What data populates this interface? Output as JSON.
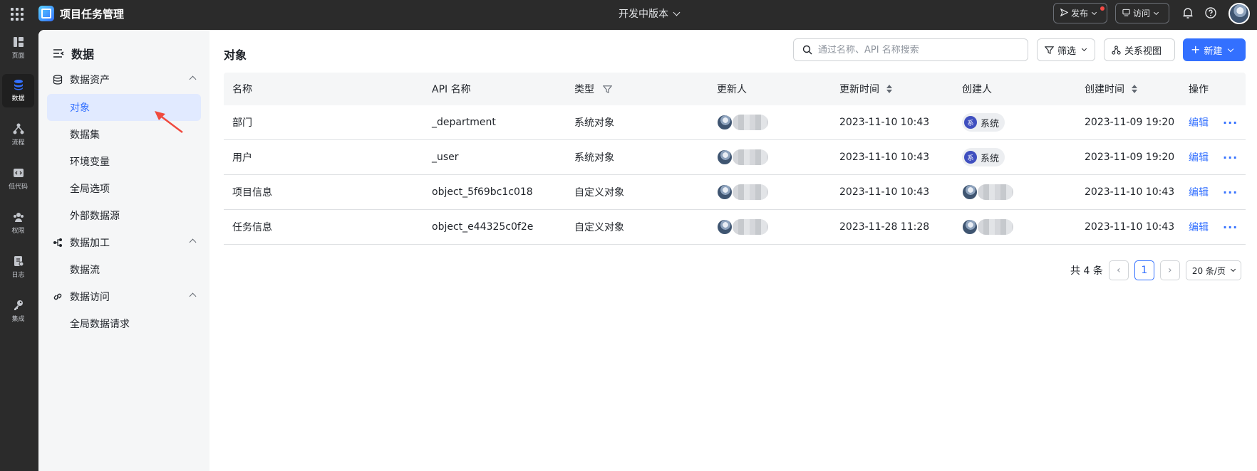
{
  "app": {
    "title": "项目任务管理",
    "version": "开发中版本"
  },
  "topbar": {
    "publish": "发布",
    "visit": "访问"
  },
  "rail": [
    {
      "label": "页面",
      "icon": "pages-icon"
    },
    {
      "label": "数据",
      "icon": "database-icon",
      "active": true
    },
    {
      "label": "流程",
      "icon": "flow-icon"
    },
    {
      "label": "低代码",
      "icon": "code-icon"
    },
    {
      "label": "权限",
      "icon": "users-icon"
    },
    {
      "label": "日志",
      "icon": "log-icon"
    },
    {
      "label": "集成",
      "icon": "key-icon"
    }
  ],
  "sidebar": {
    "title": "数据",
    "groups": [
      {
        "label": "数据资产",
        "items": [
          "对象",
          "数据集",
          "环境变量",
          "全局选项",
          "外部数据源"
        ]
      },
      {
        "label": "数据加工",
        "items": [
          "数据流"
        ]
      },
      {
        "label": "数据访问",
        "items": [
          "全局数据请求"
        ]
      }
    ]
  },
  "main": {
    "title": "对象",
    "search_placeholder": "通过名称、API 名称搜索",
    "filter": "筛选",
    "relation_view": "关系视图",
    "new": "新建"
  },
  "table": {
    "headers": {
      "name": "名称",
      "api": "API 名称",
      "type": "类型",
      "updater": "更新人",
      "updated": "更新时间",
      "creator": "创建人",
      "created": "创建时间",
      "ops": "操作"
    },
    "rows": [
      {
        "name": "部门",
        "api": "_department",
        "type": "系统对象",
        "updated": "2023-11-10 10:43",
        "creator": "系统",
        "created": "2023-11-09 19:20",
        "edit": "编辑",
        "more": "···"
      },
      {
        "name": "用户",
        "api": "_user",
        "type": "系统对象",
        "updated": "2023-11-10 10:43",
        "creator": "系统",
        "created": "2023-11-09 19:20",
        "edit": "编辑",
        "more": "···"
      },
      {
        "name": "项目信息",
        "api": "object_5f69bc1c018",
        "type": "自定义对象",
        "updated": "2023-11-10 10:43",
        "creator": "",
        "created": "2023-11-10 10:43",
        "edit": "编辑",
        "more": "···"
      },
      {
        "name": "任务信息",
        "api": "object_e44325c0f2e",
        "type": "自定义对象",
        "updated": "2023-11-28 11:28",
        "creator": "",
        "created": "2023-11-10 10:43",
        "edit": "编辑",
        "more": "···"
      }
    ],
    "system_tag_glyph": "系"
  },
  "pagination": {
    "total": "共 4 条",
    "current": "1",
    "page_size": "20 条/页"
  },
  "colors": {
    "accent": "#3370ff",
    "dark": "#2b2b2b",
    "sidebar_bg": "#f5f6f7"
  }
}
